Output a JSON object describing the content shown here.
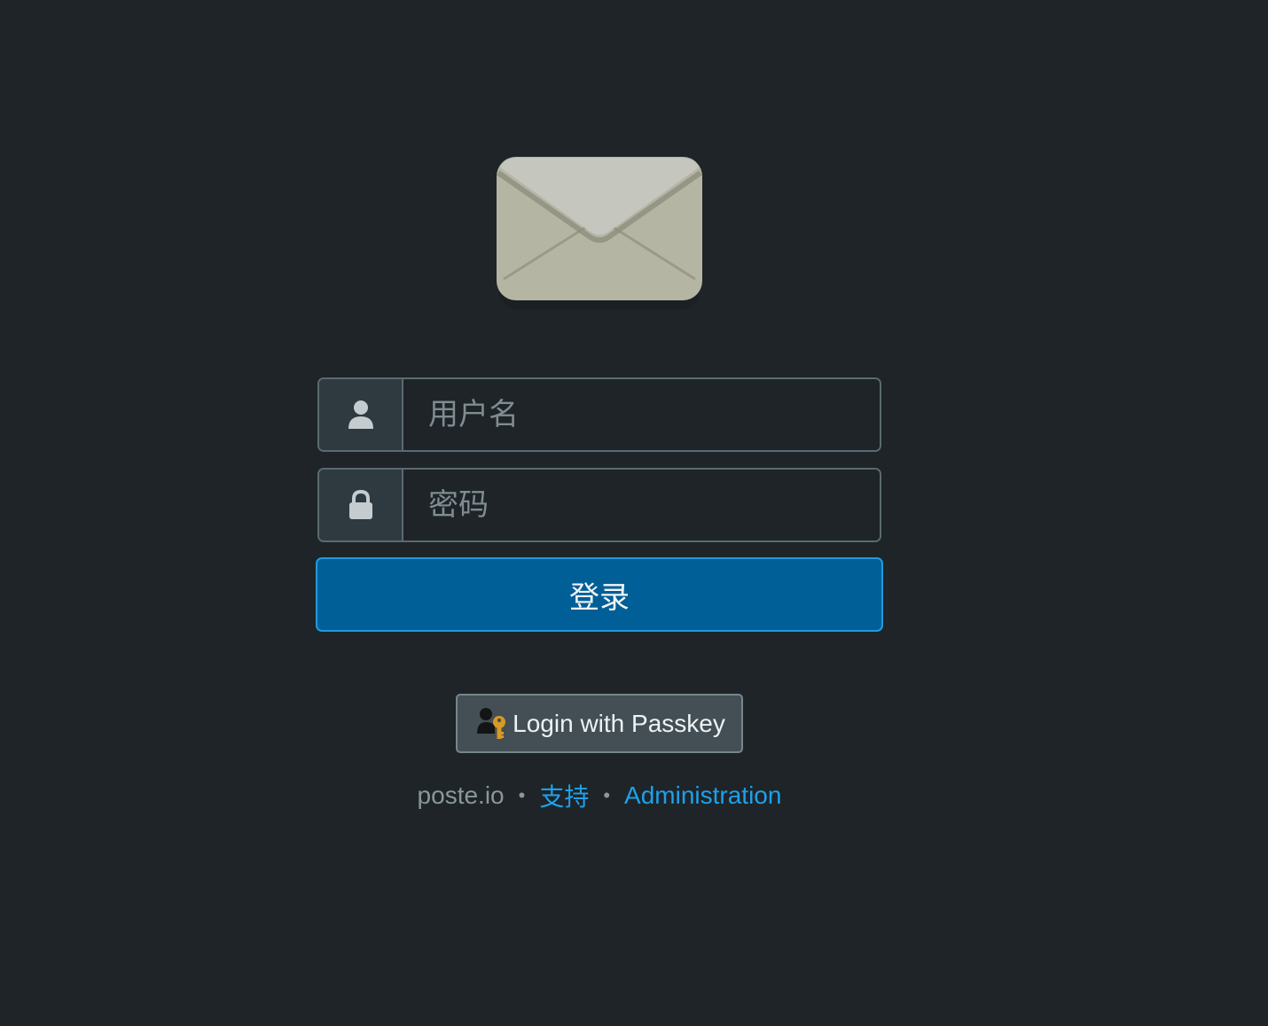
{
  "login_form": {
    "username_placeholder": "用户名",
    "password_placeholder": "密码",
    "submit_label": "登录"
  },
  "passkey_button": {
    "label": "Login with Passkey",
    "icon": "user-key-icon"
  },
  "footer": {
    "brand": "poste.io",
    "separator": "•",
    "support_link": "支持",
    "admin_link": "Administration"
  },
  "icons": {
    "logo": "envelope-icon",
    "username": "user-icon",
    "password": "lock-icon"
  },
  "colors": {
    "background": "#1e2427",
    "primary_button": "#005f96",
    "primary_border": "#1f9be0",
    "link": "#1fa0eb",
    "muted_text": "#8a979d"
  }
}
